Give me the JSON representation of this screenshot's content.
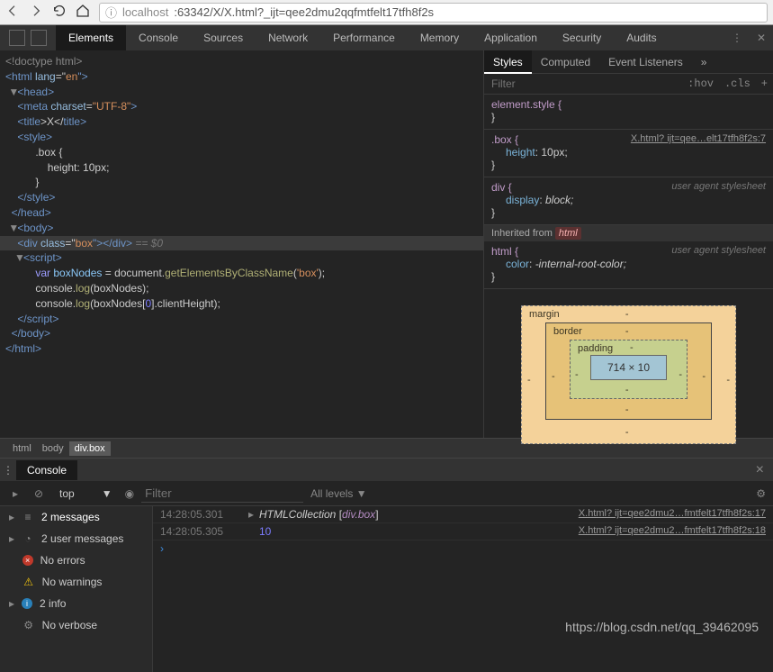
{
  "url": {
    "prefix": "localhost",
    "path": ":63342/X/X.html?_ijt=qee2dmu2qqfmtfelt17tfh8f2s"
  },
  "devtabs": [
    "Elements",
    "Console",
    "Sources",
    "Network",
    "Performance",
    "Memory",
    "Application",
    "Security",
    "Audits"
  ],
  "devtabs_active": 0,
  "dom": {
    "l1": "<!doctype html>",
    "l2a": "<",
    "l2b": "html",
    "l2c": " lang",
    "l2d": "=\"",
    "l2e": "en",
    "l2f": "\">",
    "l3a": "<",
    "l3b": "head",
    "l3c": ">",
    "l4": "<meta charset=\"UTF-8\">",
    "l5a": "<",
    "l5b": "title",
    "l5c": ">X</",
    "l5d": "title",
    "l5e": ">",
    "l6a": "<",
    "l6b": "style",
    "l6c": ">",
    "l7": ".box {",
    "l8": "height: 10px;",
    "l9": "}",
    "l10a": "</",
    "l10b": "style",
    "l10c": ">",
    "l11a": "</",
    "l11b": "head",
    "l11c": ">",
    "l12a": "<",
    "l12b": "body",
    "l12c": ">",
    "sel_open": "<",
    "sel_tag": "div",
    "sel_attr": " class",
    "sel_eq": "=\"",
    "sel_val": "box",
    "sel_close": "\"></",
    "sel_tag2": "div",
    "sel_end": ">",
    "sel_hint": " == $0",
    "l14a": "<",
    "l14b": "script",
    "l14c": ">",
    "l15a": "var ",
    "l15b": "boxNodes",
    "l15c": " = document.",
    "l15d": "getElementsByClassName",
    "l15e": "(",
    "l15f": "'box'",
    "l15g": ");",
    "l16a": "console.",
    "l16b": "log",
    "l16c": "(boxNodes);",
    "l17a": "console.",
    "l17b": "log",
    "l17c": "(boxNodes[",
    "l17d": "0",
    "l17e": "].clientHeight);",
    "l18a": "</",
    "l18b": "script",
    "l18c": ">",
    "l19a": "</",
    "l19b": "body",
    "l19c": ">",
    "l20a": "</",
    "l20b": "html",
    "l20c": ">"
  },
  "styles": {
    "tabs": [
      "Styles",
      "Computed",
      "Event Listeners"
    ],
    "filter_ph": "Filter",
    "hov": ":hov",
    "cls": ".cls",
    "r1": "element.style {",
    "r2_sel": ".box {",
    "r2_src": "X.html? ijt=qee…elt17tfh8f2s:7",
    "r2_p": "height",
    "r2_v": "10px;",
    "r3_sel": "div {",
    "r3_uas": "user agent stylesheet",
    "r3_p": "display",
    "r3_v": "block;",
    "inh": "Inherited from ",
    "inh_el": "html",
    "r4_sel": "html {",
    "r4_uas": "user agent stylesheet",
    "r4_p": "color",
    "r4_v": "-internal-root-color;"
  },
  "boxmodel": {
    "margin": "margin",
    "border": "border",
    "padding": "padding",
    "content": "714 × 10",
    "dash": "-"
  },
  "breadcrumb": [
    "html",
    "body",
    "div.box"
  ],
  "console": {
    "title": "Console",
    "context": "top",
    "filter_ph": "Filter",
    "levels": "All levels ▼",
    "side": [
      {
        "icon": "≡",
        "label": "2 messages"
      },
      {
        "icon": "◔",
        "label": "2 user messages"
      },
      {
        "icon": "err",
        "label": "No errors"
      },
      {
        "icon": "⚠",
        "label": "No warnings"
      },
      {
        "icon": "info",
        "label": "2 info"
      },
      {
        "icon": "⚙",
        "label": "No verbose"
      }
    ],
    "msgs": [
      {
        "time": "14:28:05.301",
        "arrow": "▸",
        "text_a": "HTMLCollection ",
        "text_b": "[",
        "text_c": "div.box",
        "text_d": "]",
        "src": "X.html? ijt=qee2dmu2…fmtfelt17tfh8f2s:17"
      },
      {
        "time": "14:28:05.305",
        "arrow": "",
        "text_a": "",
        "num": "10",
        "src": "X.html? ijt=qee2dmu2…fmtfelt17tfh8f2s:18"
      }
    ],
    "prompt": "›"
  },
  "watermark": "https://blog.csdn.net/qq_39462095"
}
